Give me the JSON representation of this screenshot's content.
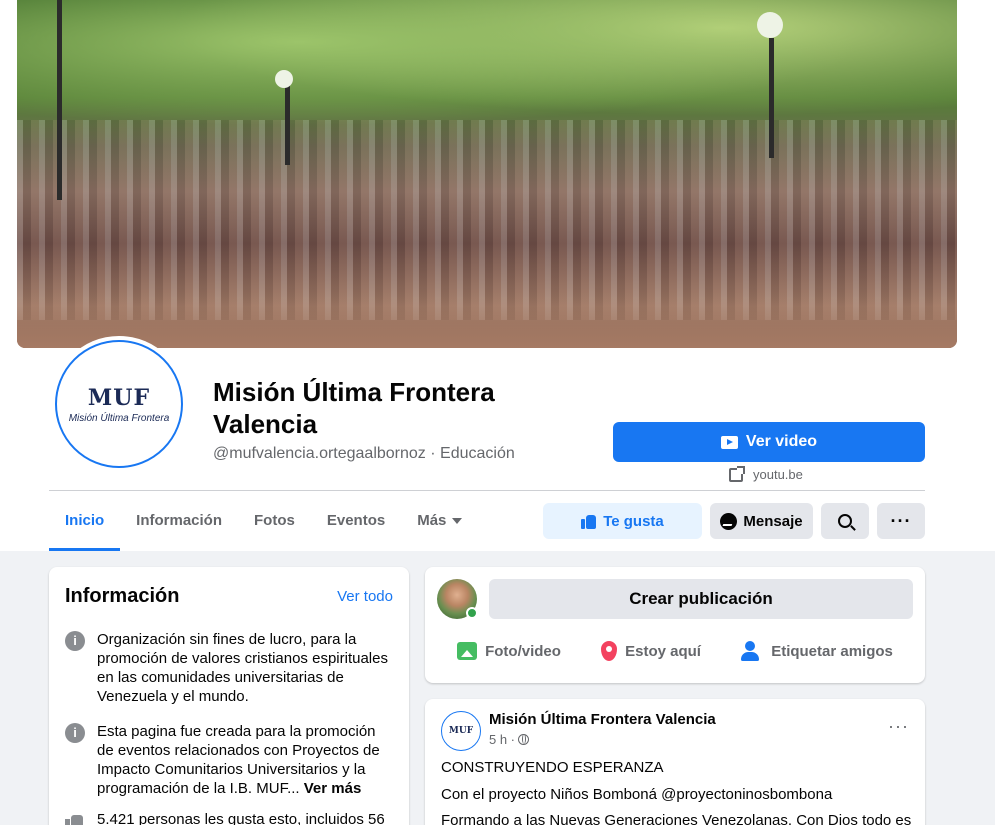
{
  "page": {
    "name": "Misión Última Frontera Valencia",
    "handle_category": "@mufvalencia.ortegaalbornoz · Educación",
    "logo_text": "MUF",
    "logo_subtext": "Misión Última Frontera"
  },
  "primary_action": {
    "label": "Ver video",
    "link_domain": "youtu.be"
  },
  "tabs": [
    {
      "label": "Inicio",
      "active": true
    },
    {
      "label": "Información"
    },
    {
      "label": "Fotos"
    },
    {
      "label": "Eventos"
    },
    {
      "label": "Más"
    }
  ],
  "actions": {
    "like": "Te gusta",
    "message": "Mensaje"
  },
  "info": {
    "title": "Información",
    "see_all": "Ver todo",
    "items": [
      {
        "text": "Organización sin fines de lucro, para la promoción de valores cristianos espirituales en las comunidades universitarias de Venezuela y el mundo."
      },
      {
        "text": "Esta pagina fue creada para la promoción de eventos relacionados con Proyectos de Impacto Comunitarios Universitarios y la programación de la I.B. MUF... ",
        "more": "Ver más"
      },
      {
        "text": "5.421 personas les gusta esto, incluidos 56"
      }
    ]
  },
  "composer": {
    "prompt": "Crear publicación",
    "actions": [
      "Foto/video",
      "Estoy aquí",
      "Etiquetar amigos"
    ]
  },
  "post": {
    "author": "Misión Última Frontera Valencia",
    "time": "5 h ·",
    "lines": [
      "CONSTRUYENDO ESPERANZA",
      "Con el proyecto Niños Bomboná @proyectoninosbombona",
      "Formando a las Nuevas Generaciones  Venezolanas. Con Dios todo es"
    ]
  },
  "colors": {
    "accent": "#1877f2",
    "background": "#f0f2f5",
    "secondary_text": "#65676b"
  }
}
